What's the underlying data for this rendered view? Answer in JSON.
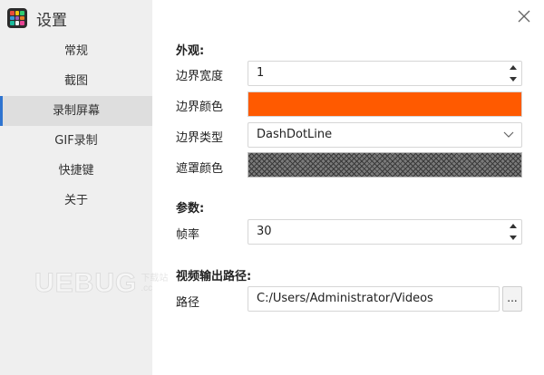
{
  "app": {
    "title": "设置",
    "logo_icon": "app-logo-icon"
  },
  "colors": {
    "accent": "#2f74d0",
    "border_color_value": "#ff5a00",
    "sidebar_bg": "#efefef",
    "active_item_bg": "#dedede"
  },
  "sidebar": {
    "items": [
      {
        "label": "常规",
        "active": false
      },
      {
        "label": "截图",
        "active": false
      },
      {
        "label": "录制屏幕",
        "active": true
      },
      {
        "label": "GIF录制",
        "active": false
      },
      {
        "label": "快捷键",
        "active": false
      },
      {
        "label": "关于",
        "active": false
      }
    ]
  },
  "appearance": {
    "section_title": "外观:",
    "border_width_label": "边界宽度",
    "border_width_value": "1",
    "border_color_label": "边界颜色",
    "border_type_label": "边界类型",
    "border_type_value": "DashDotLine",
    "mask_color_label": "遮罩颜色"
  },
  "params": {
    "section_title": "参数:",
    "frame_rate_label": "帧率",
    "frame_rate_value": "30"
  },
  "output": {
    "section_title": "视频输出路径:",
    "path_label": "路径",
    "path_value": "C:/Users/Administrator/Videos",
    "browse_label": "..."
  },
  "watermark": {
    "main": "UEBUG",
    "sub1": "下载站",
    "sub2": ".cc"
  }
}
